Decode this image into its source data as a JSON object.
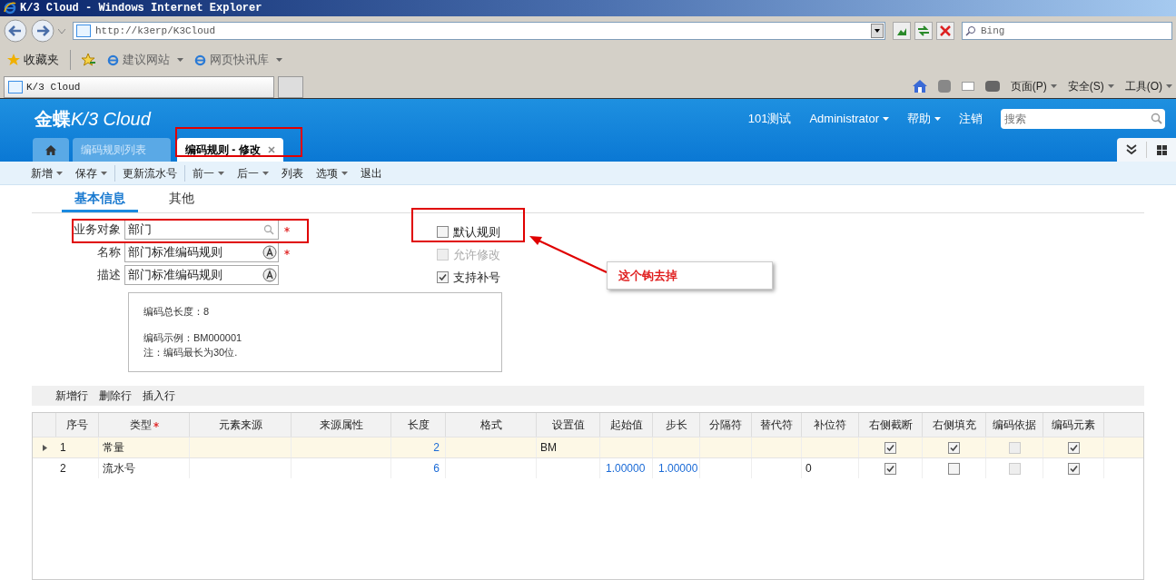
{
  "browser": {
    "title": "K/3 Cloud - Windows Internet Explorer",
    "address": "http://k3erp/K3Cloud",
    "search_placeholder": "Bing",
    "favorites": "收藏夹",
    "links": [
      "建议网站",
      "网页快讯库"
    ],
    "tab": "K/3 Cloud",
    "commands": [
      "页面(P)",
      "安全(S)",
      "工具(O)"
    ]
  },
  "app": {
    "logo_cn": "金蝶",
    "logo_en": "K/3 Cloud",
    "header_links": [
      {
        "label": "101测试",
        "dropdown": false
      },
      {
        "label": "Administrator",
        "dropdown": true
      },
      {
        "label": "帮助",
        "dropdown": true
      },
      {
        "label": "注销",
        "dropdown": false
      }
    ],
    "search_placeholder": "搜索",
    "tabs": [
      {
        "kind": "home",
        "selected": false
      },
      {
        "kind": "page",
        "label": "编码规则列表",
        "selected": false,
        "closable": false
      },
      {
        "kind": "page",
        "label": "编码规则 - 修改",
        "selected": true,
        "closable": true
      }
    ],
    "toolbar": [
      [
        {
          "label": "新增",
          "dropdown": true
        },
        {
          "label": "保存",
          "dropdown": true
        }
      ],
      [
        {
          "label": "更新流水号",
          "dropdown": false
        }
      ],
      [
        {
          "label": "前一",
          "dropdown": true
        },
        {
          "label": "后一",
          "dropdown": true
        },
        {
          "label": "列表",
          "dropdown": false
        },
        {
          "label": "选项",
          "dropdown": true
        },
        {
          "label": "退出",
          "dropdown": false
        }
      ]
    ]
  },
  "form_tabs": [
    {
      "label": "基本信息",
      "selected": true
    },
    {
      "label": "其他",
      "selected": false
    }
  ],
  "fields": [
    {
      "label": "业务对象",
      "value": "部门",
      "lookup": true,
      "required": true
    },
    {
      "label": "名称",
      "value": "部门标准编码规则",
      "lookup": false,
      "required": true
    },
    {
      "label": "描述",
      "value": "部门标准编码规则",
      "lookup": false,
      "required": false
    }
  ],
  "checkboxes": [
    {
      "label": "默认规则",
      "checked": false,
      "disabled": false
    },
    {
      "label": "允许修改",
      "checked": false,
      "disabled": true
    },
    {
      "label": "支持补号",
      "checked": true,
      "disabled": false
    }
  ],
  "info": [
    [
      "编码总长度：8"
    ],
    [
      "编码示例：BM000001",
      "注：编码最长为30位."
    ]
  ],
  "annotation": "这个钩去掉",
  "grid_toolbar": [
    "新增行",
    "删除行",
    "插入行"
  ],
  "columns": [
    {
      "label": "序号",
      "kind": "text",
      "required": false
    },
    {
      "label": "类型",
      "kind": "text",
      "required": true
    },
    {
      "label": "元素来源",
      "kind": "text",
      "required": false
    },
    {
      "label": "来源属性",
      "kind": "text",
      "required": false
    },
    {
      "label": "长度",
      "kind": "number",
      "required": false
    },
    {
      "label": "格式",
      "kind": "text",
      "required": false
    },
    {
      "label": "设置值",
      "kind": "text",
      "required": false
    },
    {
      "label": "起始值",
      "kind": "decimal",
      "required": false
    },
    {
      "label": "步长",
      "kind": "decimal",
      "required": false
    },
    {
      "label": "分隔符",
      "kind": "text",
      "required": false
    },
    {
      "label": "替代符",
      "kind": "text",
      "required": false
    },
    {
      "label": "补位符",
      "kind": "text",
      "required": false
    },
    {
      "label": "右侧截断",
      "kind": "check",
      "required": false
    },
    {
      "label": "右侧填充",
      "kind": "check",
      "required": false
    },
    {
      "label": "编码依据",
      "kind": "check",
      "required": false
    },
    {
      "label": "编码元素",
      "kind": "check",
      "required": false
    }
  ],
  "rows": [
    {
      "selected": true,
      "cells": [
        {
          "text": "1"
        },
        {
          "text": "常量"
        },
        {},
        {},
        {
          "text": "2"
        },
        {},
        {
          "text": "BM"
        },
        {},
        {},
        {},
        {},
        {},
        {
          "checked": true,
          "disabled": false
        },
        {
          "checked": true,
          "disabled": false
        },
        {
          "checked": false,
          "disabled": true
        },
        {
          "checked": true,
          "disabled": false
        }
      ]
    },
    {
      "selected": false,
      "cells": [
        {
          "text": "2"
        },
        {
          "text": "流水号"
        },
        {},
        {},
        {
          "text": "6"
        },
        {},
        {},
        {
          "text": "1.00000"
        },
        {
          "text": "1.00000"
        },
        {},
        {},
        {
          "text": "0"
        },
        {
          "checked": true,
          "disabled": false
        },
        {
          "checked": false,
          "disabled": false
        },
        {
          "checked": false,
          "disabled": true
        },
        {
          "checked": true,
          "disabled": false
        }
      ]
    }
  ]
}
